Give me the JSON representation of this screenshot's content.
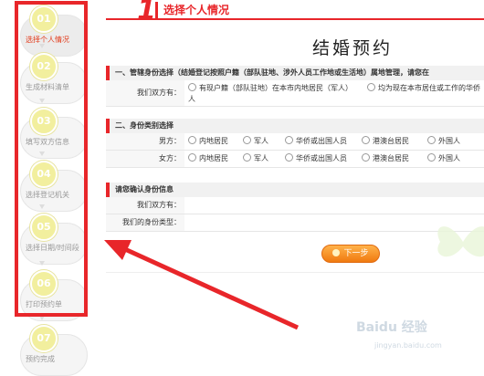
{
  "header": {
    "step_number": "1",
    "step_title": "选择个人情况"
  },
  "page_title": "结婚预约",
  "steps": [
    {
      "num": "01",
      "label": "选择个人情况",
      "active": true
    },
    {
      "num": "02",
      "label": "生成材料清单"
    },
    {
      "num": "03",
      "label": "填写双方信息"
    },
    {
      "num": "04",
      "label": "选择登记机关"
    },
    {
      "num": "05",
      "label": "选择日期/时间段"
    },
    {
      "num": "06",
      "label": "打印预约单"
    },
    {
      "num": "07",
      "label": "预约完成"
    }
  ],
  "section1": {
    "title": "一、管辖身份选择（结婚登记按照户籍（部队驻地、涉外人员工作地或生活地）属地管理，请您在",
    "label": "我们双方有：",
    "opt1": "有现户籍（部队驻地）在本市内地居民（军人）",
    "opt2": "均为现在本市居住或工作的华侨",
    "opt2_cont": "人"
  },
  "section2": {
    "title": "二、身份类别选择",
    "male_label": "男方：",
    "female_label": "女方：",
    "options": [
      "内地居民",
      "军人",
      "华侨或出国人员",
      "港澳台居民",
      "外国人"
    ]
  },
  "section3": {
    "title": "请您确认身份信息",
    "label1": "我们双方有：",
    "label2": "我们的身份类型："
  },
  "next_button": "下一步",
  "watermark": {
    "main": "Baidu 经验",
    "sub": "jingyan.baidu.com"
  },
  "colors": {
    "accent": "#e8262a",
    "button": "#f07a10"
  }
}
